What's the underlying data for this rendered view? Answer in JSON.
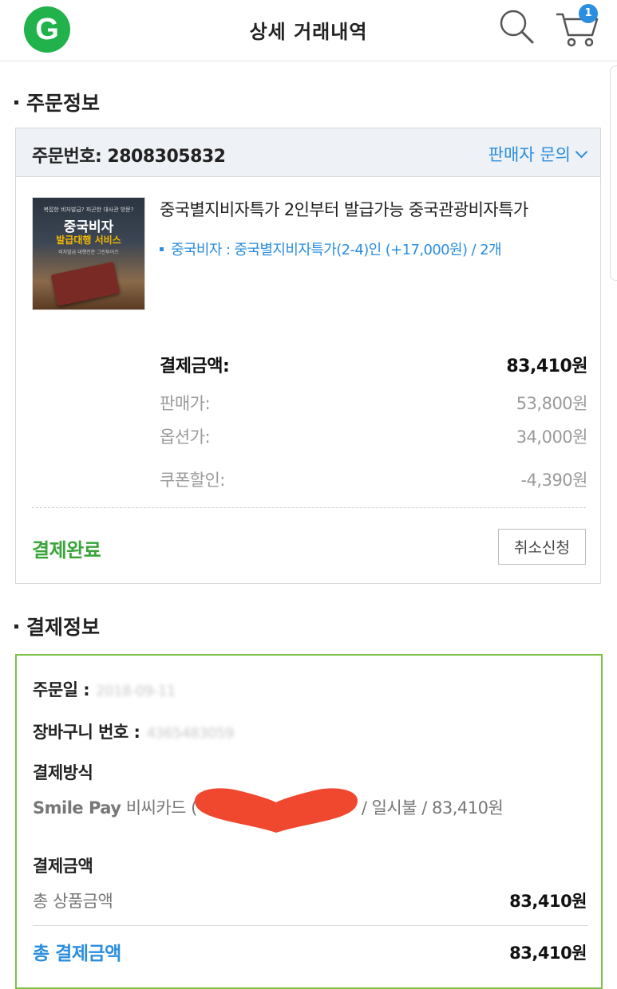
{
  "header": {
    "logo_letter": "G",
    "title": "상세 거래내역",
    "cart_count": "1"
  },
  "order_section": {
    "title": "주문정보",
    "order_number": "주문번호: 2808305832",
    "seller_inquiry": "판매자 문의",
    "thumbnail": {
      "small_text": "복잡한 비자발급? 피곤한 대사관 방문?",
      "title": "중국비자",
      "subtitle": "발급대행 서비스",
      "footnote": "비자발급 대행전문 그린투어즈"
    },
    "product_name": "중국별지비자특가 2인부터 발급가능 중국관광비자특가",
    "product_option": "중국비자 : 중국별지비자특가(2-4)인 (+17,000원) / 2개",
    "payment_amount_label": "결제금액:",
    "payment_amount": "83,410원",
    "sale_price_label": "판매가:",
    "sale_price": "53,800원",
    "option_price_label": "옵션가:",
    "option_price": "34,000원",
    "coupon_label": "쿠폰할인:",
    "coupon_discount": "-4,390원",
    "status": "결제완료",
    "cancel_button": "취소신청"
  },
  "payment_section": {
    "title": "결제정보",
    "order_date_label": "주문일 :",
    "order_date": "2018-09-11",
    "cart_no_label": "장바구니 번호 :",
    "cart_no": "4365483059",
    "method_label": "결제방식",
    "method_brand": "Smile Pay",
    "method_card": "비씨카드 (",
    "method_tail": "/ 일시불 / 83,410원",
    "amount_label": "결제금액",
    "total_product_label": "총 상품금액",
    "total_product": "83,410원",
    "total_payment_label": "총 결제금액",
    "total_payment": "83,410원"
  },
  "colors": {
    "accent_blue": "#2b8ede",
    "status_green": "#3aa53a",
    "box_green": "#7cc24a",
    "logo_green": "#22b24c",
    "heart_red": "#f0472f"
  },
  "icons": [
    "logo-icon",
    "search-icon",
    "cart-icon",
    "chevron-down-icon",
    "heart-redaction"
  ]
}
